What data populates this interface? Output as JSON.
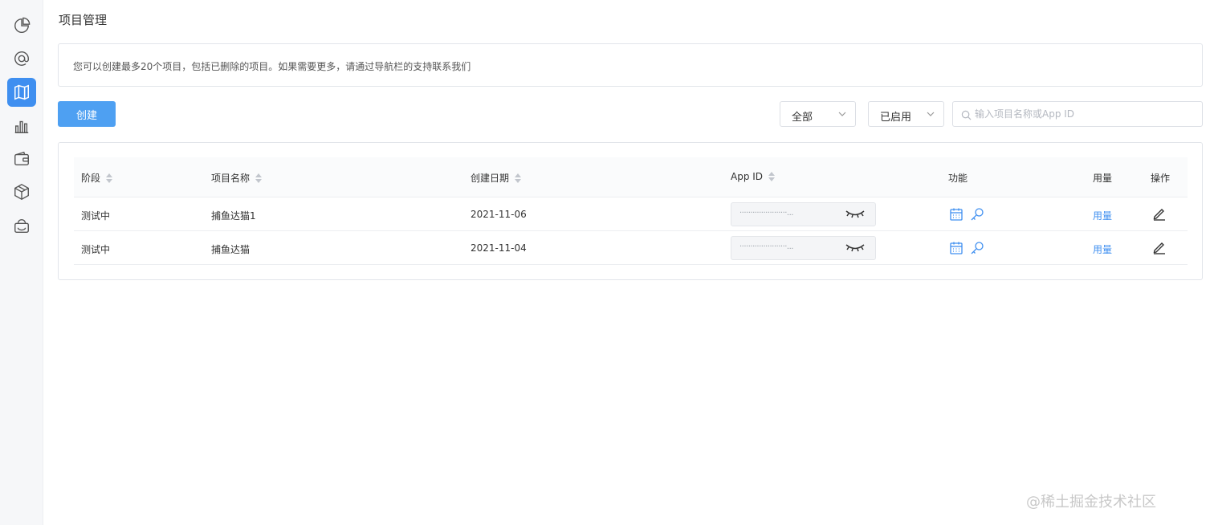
{
  "sidebar": {
    "items": [
      {
        "name": "pie-chart-icon",
        "active": false
      },
      {
        "name": "at-sign-icon",
        "active": false
      },
      {
        "name": "map-icon",
        "active": true
      },
      {
        "name": "bar-chart-icon",
        "active": false
      },
      {
        "name": "wallet-icon",
        "active": false
      },
      {
        "name": "package-icon",
        "active": false
      },
      {
        "name": "cloud-box-icon",
        "active": false
      }
    ]
  },
  "header": {
    "title": "项目管理"
  },
  "notice": {
    "text": "您可以创建最多20个项目，包括已删除的项目。如果需要更多，请通过导航栏的支持联系我们"
  },
  "toolbar": {
    "create_label": "创建",
    "filter_stage": "全部",
    "filter_status": "已启用",
    "search_placeholder": "输入项目名称或App ID"
  },
  "table": {
    "columns": {
      "stage": "阶段",
      "name": "项目名称",
      "created": "创建日期",
      "app_id": "App ID",
      "features": "功能",
      "usage": "用量",
      "actions": "操作"
    },
    "rows": [
      {
        "stage": "测试中",
        "name": "捕鱼达猫1",
        "created": "2021-11-06",
        "app_id_mask": "······················...",
        "usage_link": "用量"
      },
      {
        "stage": "测试中",
        "name": "捕鱼达猫",
        "created": "2021-11-04",
        "app_id_mask": "······················...",
        "usage_link": "用量"
      }
    ]
  },
  "watermark": "@稀土掘金技术社区",
  "colors": {
    "accent": "#3f8ff0",
    "button": "#4ea0f2",
    "sidebar_bg": "#f6f7f9"
  }
}
